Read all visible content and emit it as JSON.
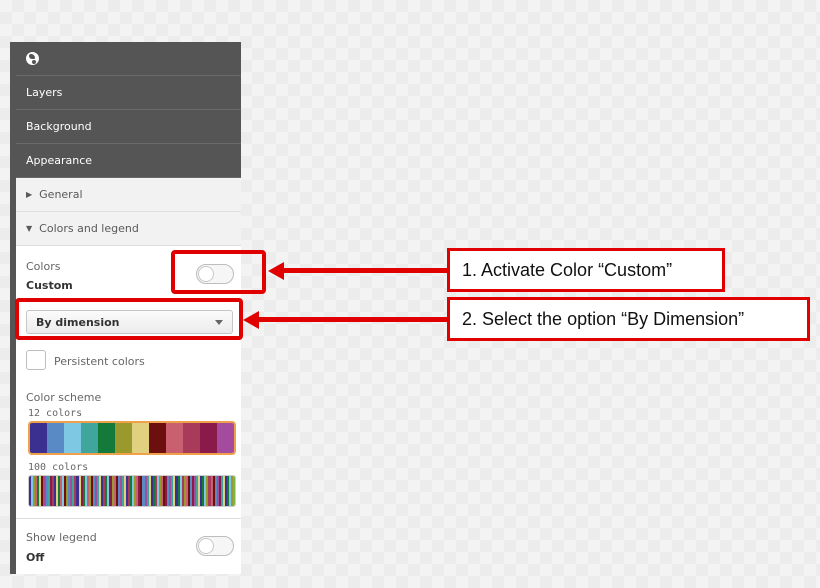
{
  "panel": {
    "sections": [
      "Layers",
      "Background",
      "Appearance"
    ],
    "general_label": "General",
    "colors_legend_label": "Colors and legend",
    "colors": {
      "label": "Colors",
      "value": "Custom",
      "toggle_on": false
    },
    "dropdown": {
      "selected": "By dimension"
    },
    "persistent_colors": {
      "label": "Persistent colors",
      "checked": false
    },
    "color_scheme": {
      "label": "Color scheme",
      "option_12_label": "12 colors",
      "option_100_label": "100 colors",
      "colors_12": [
        "#3b2f8f",
        "#5a8ac6",
        "#7ec8e3",
        "#40a59a",
        "#147a3a",
        "#9a9a2c",
        "#e0d080",
        "#6e0f0f",
        "#c96070",
        "#a83a5a",
        "#8a1a4a",
        "#a44b9e"
      ],
      "colors_100": [
        "#3b2f8f",
        "#7ec8e3",
        "#9a9a2c",
        "#c96070",
        "#147a3a",
        "#e0d080",
        "#6e0f0f",
        "#a44b9e",
        "#5a8ac6",
        "#40a59a",
        "#8a1a4a",
        "#a83a5a",
        "#3b2f8f",
        "#e0d080",
        "#147a3a",
        "#c96070",
        "#7ec8e3",
        "#6e0f0f",
        "#9a9a2c",
        "#5a8ac6",
        "#a44b9e",
        "#40a59a",
        "#a83a5a",
        "#3b2f8f",
        "#e0d080",
        "#8a1a4a",
        "#147a3a",
        "#7ec8e3",
        "#c96070",
        "#9a9a2c",
        "#6e0f0f",
        "#5a8ac6",
        "#a44b9e",
        "#40a59a",
        "#e0d080",
        "#3b2f8f",
        "#a83a5a",
        "#147a3a",
        "#7ec8e3",
        "#8a1a4a",
        "#9a9a2c",
        "#c96070",
        "#6e0f0f",
        "#5a8ac6",
        "#a44b9e",
        "#40a59a",
        "#e0d080",
        "#3b2f8f",
        "#a83a5a",
        "#147a3a",
        "#7ec8e3",
        "#9a9a2c",
        "#c96070",
        "#8a1a4a",
        "#6e0f0f",
        "#5a8ac6",
        "#a44b9e",
        "#40a59a",
        "#e0d080",
        "#3b2f8f",
        "#147a3a",
        "#a83a5a",
        "#7ec8e3",
        "#9a9a2c",
        "#c96070",
        "#6e0f0f",
        "#8a1a4a",
        "#5a8ac6",
        "#a44b9e",
        "#40a59a",
        "#e0d080",
        "#3b2f8f",
        "#147a3a",
        "#7ec8e3",
        "#a83a5a",
        "#9a9a2c",
        "#c96070",
        "#6e0f0f",
        "#5a8ac6",
        "#8a1a4a",
        "#a44b9e",
        "#40a59a",
        "#e0d080",
        "#3b2f8f",
        "#147a3a",
        "#7ec8e3",
        "#9a9a2c",
        "#a83a5a",
        "#c96070",
        "#6e0f0f",
        "#5a8ac6",
        "#a44b9e",
        "#8a1a4a",
        "#40a59a",
        "#e0d080",
        "#3b2f8f",
        "#147a3a",
        "#7ec8e3",
        "#9a9a2c",
        "#7ab648"
      ]
    },
    "show_legend": {
      "label": "Show legend",
      "value": "Off",
      "toggle_on": false
    }
  },
  "annotations": {
    "step1": "1. Activate Color “Custom”",
    "step2": "2. Select the option “By Dimension”",
    "highlight_color": "#e10000"
  },
  "icons": {
    "header": "globe-icon",
    "general_expander": "triangle-right-icon",
    "colors_expander": "triangle-down-icon",
    "dropdown_caret": "chevron-down-icon"
  }
}
